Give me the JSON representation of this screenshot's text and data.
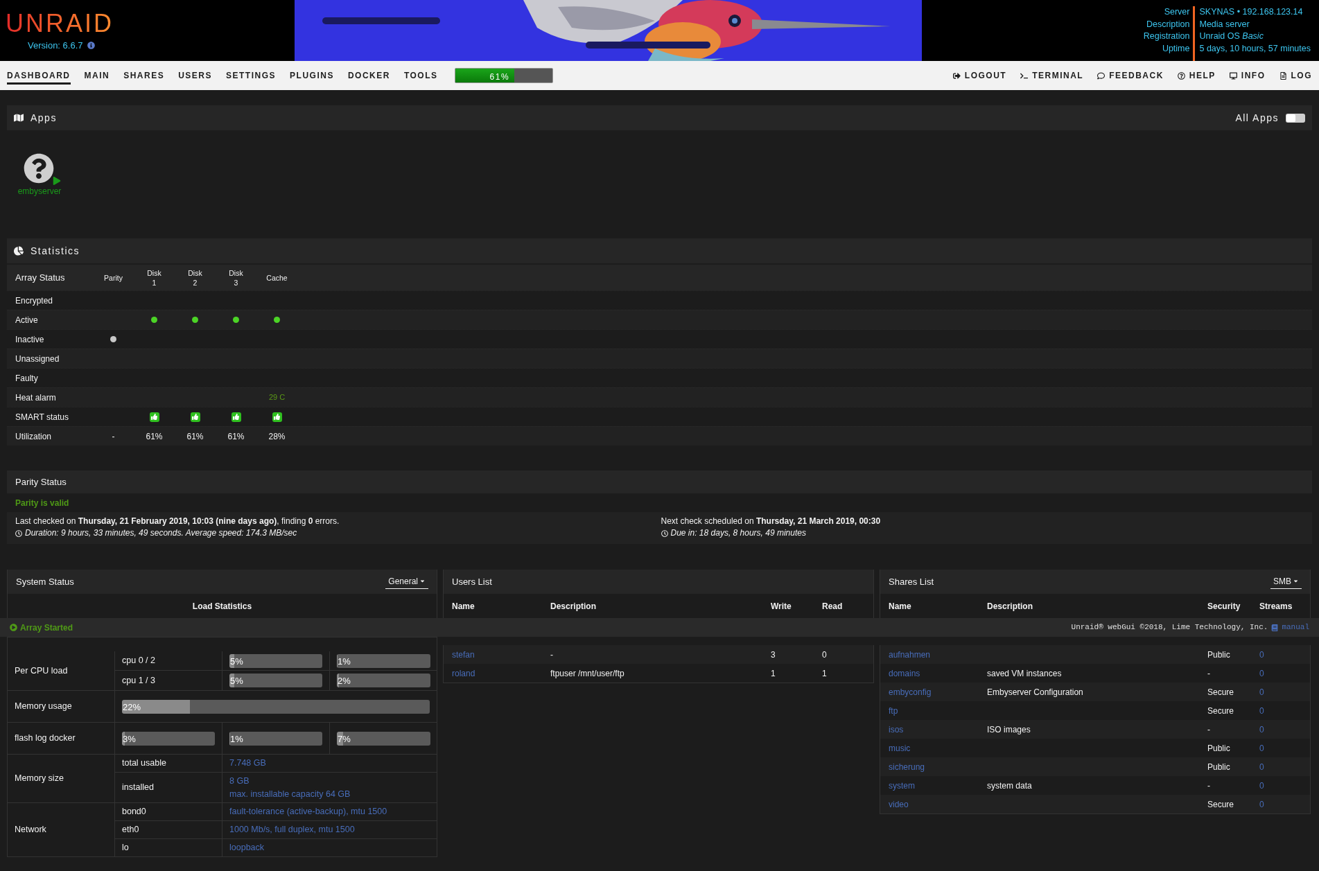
{
  "header": {
    "logo": "UNRAID",
    "version": "Version: 6.6.7",
    "info": [
      {
        "label": "Server",
        "value": "SKYNAS • 192.168.123.14"
      },
      {
        "label": "Description",
        "value": "Media server"
      },
      {
        "label": "Registration",
        "value": "Unraid OS *Basic*"
      },
      {
        "label": "Uptime",
        "value": "5 days, 10 hours, 57 minutes"
      }
    ]
  },
  "nav": {
    "tabs": [
      {
        "label": "DASHBOARD",
        "selected": true
      },
      {
        "label": "MAIN",
        "selected": false
      },
      {
        "label": "SHARES",
        "selected": false
      },
      {
        "label": "USERS",
        "selected": false
      },
      {
        "label": "SETTINGS",
        "selected": false
      },
      {
        "label": "PLUGINS",
        "selected": false
      },
      {
        "label": "DOCKER",
        "selected": false
      },
      {
        "label": "TOOLS",
        "selected": false
      }
    ],
    "usage": {
      "label": "61%",
      "level": 0.61
    },
    "actions": [
      {
        "kind": "logout",
        "label": "LOGOUT"
      },
      {
        "kind": "terminal",
        "label": "TERMINAL"
      },
      {
        "kind": "feedback",
        "label": "FEEDBACK"
      },
      {
        "kind": "help",
        "label": "HELP"
      },
      {
        "kind": "info",
        "label": "INFO"
      },
      {
        "kind": "log",
        "label": "LOG"
      }
    ]
  },
  "apps": {
    "title": "Apps",
    "toggle_label": "All Apps",
    "toggle_on": false,
    "items": [
      {
        "name": "embyserver",
        "running": true
      }
    ]
  },
  "statistics": {
    "title": "Statistics",
    "heading": "Array Status",
    "columns": [
      "Parity",
      "Disk\n1",
      "Disk\n2",
      "Disk\n3",
      "Cache"
    ],
    "rows": [
      {
        "label": "Encrypted",
        "cells": [
          {
            "kind": "empty"
          },
          {
            "kind": "empty"
          },
          {
            "kind": "empty"
          },
          {
            "kind": "empty"
          },
          {
            "kind": "empty"
          }
        ]
      },
      {
        "label": "Active",
        "cells": [
          {
            "kind": "empty"
          },
          {
            "kind": "dot",
            "color": "#4cd426"
          },
          {
            "kind": "dot",
            "color": "#4cd426"
          },
          {
            "kind": "dot",
            "color": "#4cd426"
          },
          {
            "kind": "dot",
            "color": "#4cd426"
          }
        ]
      },
      {
        "label": "Inactive",
        "cells": [
          {
            "kind": "dot",
            "color": "#c8c8c8"
          },
          {
            "kind": "empty"
          },
          {
            "kind": "empty"
          },
          {
            "kind": "empty"
          },
          {
            "kind": "empty"
          }
        ]
      },
      {
        "label": "Unassigned",
        "cells": [
          {
            "kind": "empty"
          },
          {
            "kind": "empty"
          },
          {
            "kind": "empty"
          },
          {
            "kind": "empty"
          },
          {
            "kind": "empty"
          }
        ]
      },
      {
        "label": "Faulty",
        "cells": [
          {
            "kind": "empty"
          },
          {
            "kind": "empty"
          },
          {
            "kind": "empty"
          },
          {
            "kind": "empty"
          },
          {
            "kind": "empty"
          }
        ]
      },
      {
        "label": "Heat alarm",
        "cells": [
          {
            "kind": "empty"
          },
          {
            "kind": "empty"
          },
          {
            "kind": "empty"
          },
          {
            "kind": "empty"
          },
          {
            "kind": "temp",
            "text": "29 C"
          }
        ]
      },
      {
        "label": "SMART status",
        "cells": [
          {
            "kind": "empty"
          },
          {
            "kind": "smart"
          },
          {
            "kind": "smart"
          },
          {
            "kind": "smart"
          },
          {
            "kind": "smart"
          }
        ]
      },
      {
        "label": "Utilization",
        "cells": [
          {
            "kind": "text",
            "text": "-"
          },
          {
            "kind": "text",
            "text": "61%"
          },
          {
            "kind": "text",
            "text": "61%"
          },
          {
            "kind": "text",
            "text": "61%"
          },
          {
            "kind": "text",
            "text": "28%"
          }
        ]
      }
    ]
  },
  "parity": {
    "title": "Parity Status",
    "state": "Parity is valid",
    "last": "Last checked on **Thursday, 21 February 2019, 10:03 (nine days ago)**, finding **0** errors.",
    "duration": "Duration: 9 hours, 33 minutes, 49 seconds. Average speed: 174.3 MB/sec",
    "next": "Next check scheduled on **Thursday, 21 March 2019, 00:30**",
    "due": "Due in: 18 days, 8 hours, 49 minutes"
  },
  "system": {
    "title": "System Status",
    "select": "General",
    "section": "Load Statistics",
    "rows": [
      {
        "kind": "cpus",
        "label": "Per CPU load",
        "items": [
          {
            "name": "cpu 0 / 2",
            "bars": [
              {
                "label": "5%",
                "level": 0.05
              },
              {
                "label": "1%",
                "level": 0.01
              }
            ]
          },
          {
            "name": "cpu 1 / 3",
            "bars": [
              {
                "label": "5%",
                "level": 0.05
              },
              {
                "label": "2%",
                "level": 0.02
              }
            ]
          }
        ]
      },
      {
        "kind": "bar",
        "label": "Memory usage",
        "bar": {
          "label": "22%",
          "level": 0.22
        }
      },
      {
        "kind": "bars",
        "label": "flash log docker",
        "bars": [
          {
            "label": "3%",
            "level": 0.03
          },
          {
            "label": "1%",
            "level": 0.01
          },
          {
            "label": "7%",
            "level": 0.07
          }
        ]
      },
      {
        "kind": "pairs",
        "label": "Memory size",
        "items": [
          {
            "name": "total usable",
            "values": [
              "7.748 GB"
            ]
          },
          {
            "name": "installed",
            "values": [
              "8 GB",
              "max. installable capacity 64 GB"
            ]
          }
        ]
      },
      {
        "kind": "pairs",
        "label": "Network",
        "items": [
          {
            "name": "bond0",
            "values": [
              "fault-tolerance (active-backup), mtu 1500"
            ]
          },
          {
            "name": "eth0",
            "values": [
              "1000 Mb/s, full duplex, mtu 1500"
            ]
          },
          {
            "name": "lo",
            "values": [
              "loopback"
            ]
          }
        ]
      }
    ]
  },
  "footer": {
    "status": "Array Started",
    "copyright": "Unraid® webGui ©2018, Lime Technology, Inc.",
    "manual": "manual"
  },
  "users": {
    "title": "Users List",
    "columns": [
      "Name",
      "Description",
      "Write",
      "Read"
    ],
    "rows": [
      [
        "stefan",
        "-",
        "3",
        "0"
      ],
      [
        "roland",
        "ftpuser /mnt/user/ftp",
        "1",
        "1"
      ]
    ]
  },
  "shares": {
    "title": "Shares List",
    "select": "SMB",
    "columns": [
      "Name",
      "Description",
      "Security",
      "Streams"
    ],
    "rows": [
      [
        "aufnahmen",
        "",
        "Public",
        "0"
      ],
      [
        "domains",
        "saved VM instances",
        "-",
        "0"
      ],
      [
        "embyconfig",
        "Embyserver Configuration",
        "Secure",
        "0"
      ],
      [
        "ftp",
        "",
        "Secure",
        "0"
      ],
      [
        "isos",
        "ISO images",
        "-",
        "0"
      ],
      [
        "music",
        "",
        "Public",
        "0"
      ],
      [
        "sicherung",
        "",
        "Public",
        "0"
      ],
      [
        "system",
        "system data",
        "-",
        "0"
      ],
      [
        "video",
        "",
        "Secure",
        "0"
      ]
    ]
  }
}
